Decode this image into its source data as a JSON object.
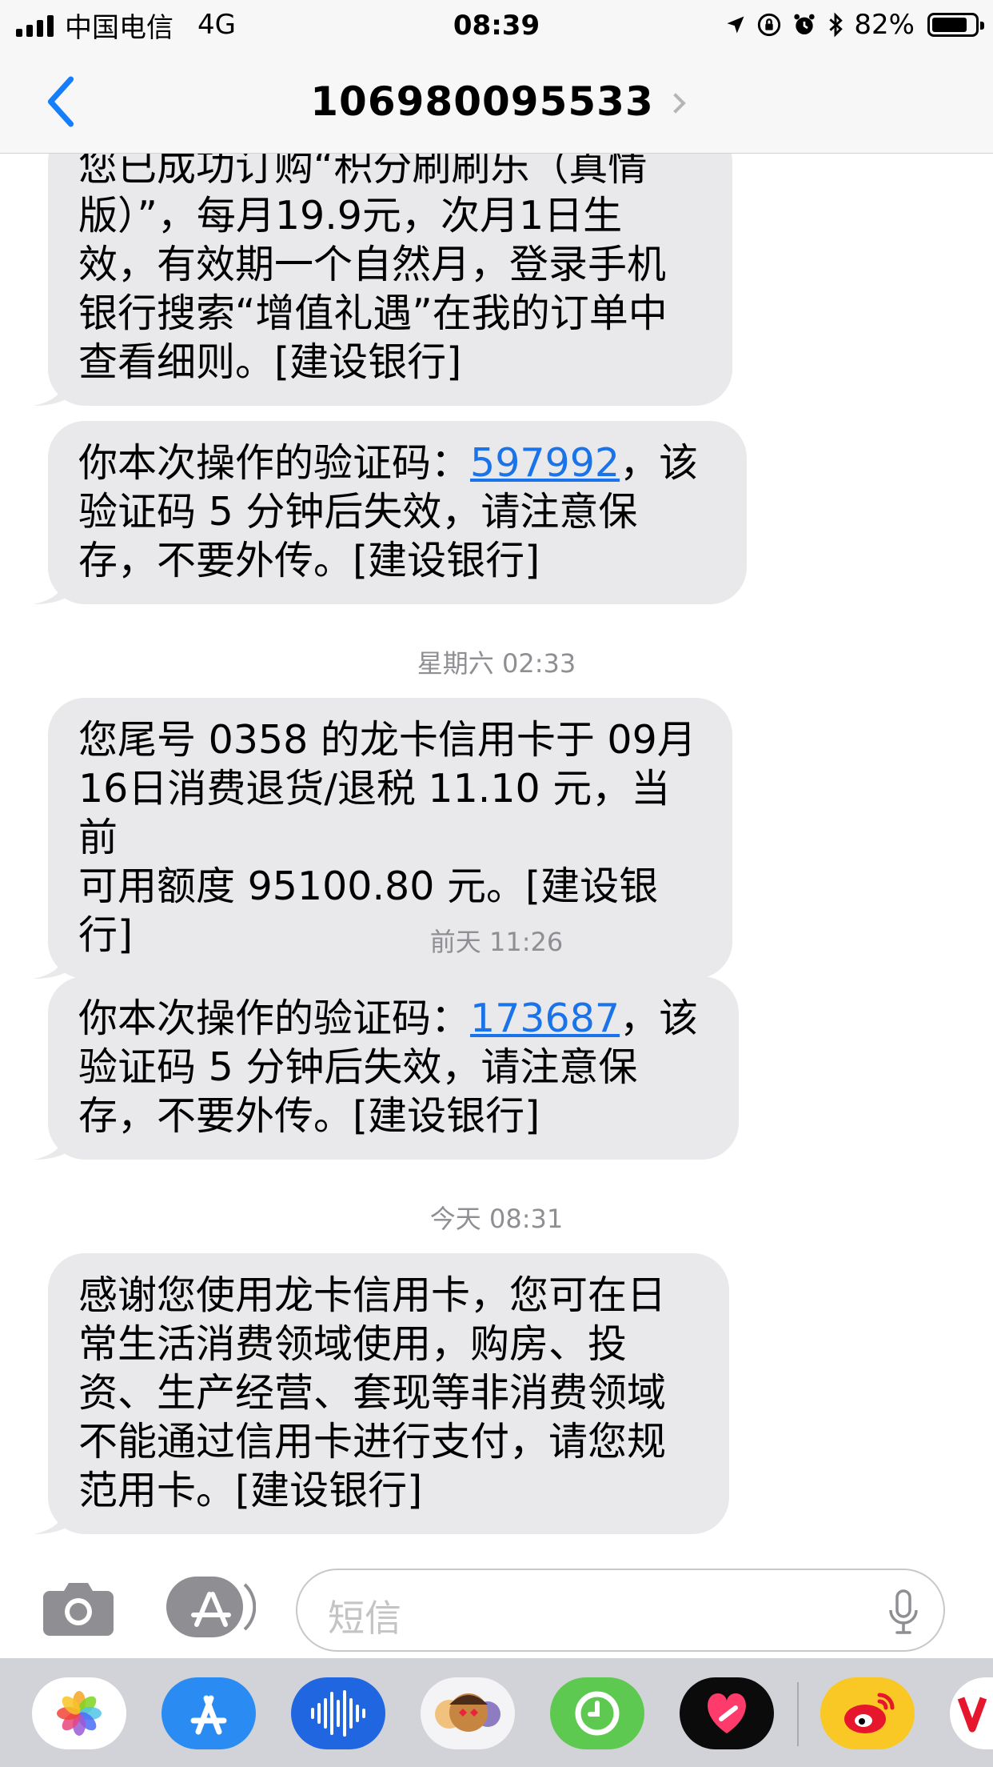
{
  "status_bar": {
    "carrier": "中国电信",
    "network": "4G",
    "time": "08:39",
    "battery": "82%",
    "battery_level": 0.82
  },
  "header": {
    "title": "106980095533"
  },
  "messages": [
    {
      "lines": [
        "您已成功订购“积分刷刷乐（真情",
        "版）”，每月19.9元，次月1日生",
        "效，有效期一个自然月，登录手机",
        "银行搜索“增值礼遇”在我的订单中",
        "查看细则。[建设银行]"
      ]
    },
    {
      "pre": "你本次操作的验证码：",
      "code": "597992",
      "post": "，该",
      "lines": [
        "验证码 5 分钟后失效，请注意保",
        "存，不要外传。[建设银行]"
      ]
    },
    {
      "timestamp": "星期六 02:33",
      "lines": [
        "您尾号 0358 的龙卡信用卡于 09月",
        "16日消费退货/退税 11.10 元，当前",
        "可用额度 95100.80 元。[建设银行]"
      ]
    },
    {
      "timestamp": "前天 11:26",
      "pre": "你本次操作的验证码：",
      "code": "173687",
      "post": "，该",
      "lines": [
        "验证码 5 分钟后失效，请注意保",
        "存，不要外传。[建设银行]"
      ]
    },
    {
      "timestamp": "今天 08:31",
      "lines": [
        "感谢您使用龙卡信用卡，您可在日",
        "常生活消费领域使用，购房、投",
        "资、生产经营、套现等非消费领域",
        "不能通过信用卡进行支付，请您规",
        "范用卡。[建设银行]"
      ]
    }
  ],
  "input": {
    "placeholder": "短信"
  },
  "app_drawer": {
    "apps": [
      "photos-app-icon",
      "app-store-app-icon",
      "audio-app-icon",
      "memoji-app-icon",
      "activity-app-icon",
      "digital-touch-app-icon",
      "weibo-app-icon",
      "partial-app-icon"
    ]
  },
  "colors": {
    "bubble": "#e9e9eb",
    "link": "#1a73e8",
    "ios_blue": "#147efb",
    "timestamp": "#8e8e93"
  }
}
